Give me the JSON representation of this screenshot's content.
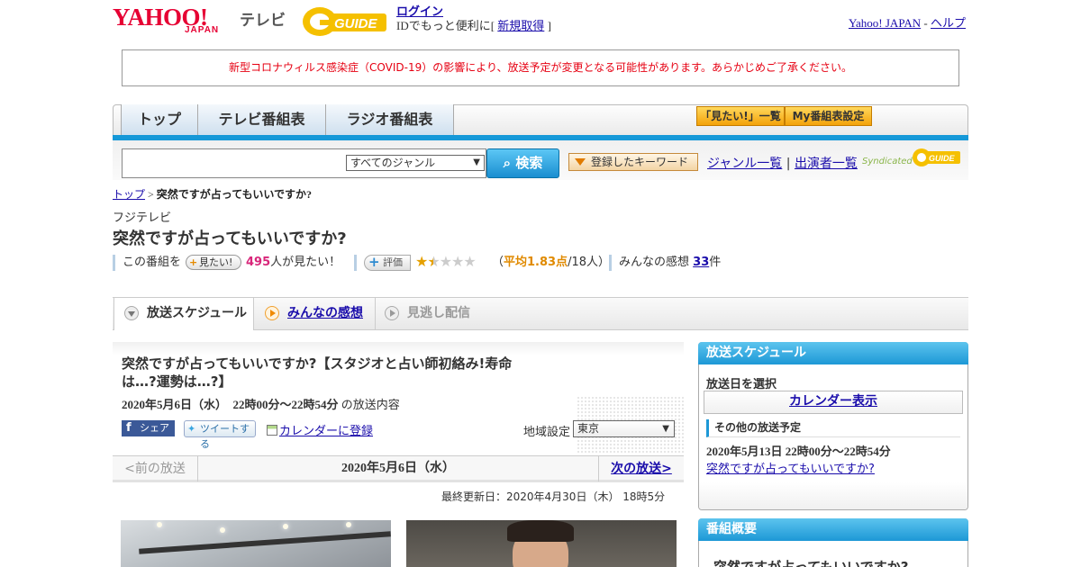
{
  "header": {
    "logo_text": "YAHOO!",
    "logo_sub": "JAPAN",
    "tv_label": "テレビ",
    "gguide_logo": "G GUIDE",
    "login": "ログイン",
    "login_desc": "IDでもっと便利に[",
    "signup": "新規取得",
    "login_desc_end": "]",
    "yahoo_japan": "Yahoo! JAPAN",
    "separator": "-",
    "help": "ヘルプ"
  },
  "notice": "新型コロナウィルス感染症（COVID-19）の影響により、放送予定が変更となる可能性があります。あらかじめご了承ください。",
  "nav": {
    "tabs": [
      "トップ",
      "テレビ番組表",
      "ラジオ番組表"
    ],
    "mitai_list": "「見たい!」一覧",
    "my_settings": "My番組表設定"
  },
  "search": {
    "genre": "すべてのジャンル",
    "button": "検索",
    "keyword_button": "登録したキーワード",
    "genre_list": "ジャンル一覧",
    "sep": "|",
    "performer_list": "出演者一覧",
    "syndicated": "Syndicated"
  },
  "breadcrumb": {
    "top": "トップ",
    "arrow": ">",
    "current": "突然ですが占ってもいいですか?"
  },
  "program": {
    "channel": "フジテレビ",
    "title": "突然ですが占ってもいいですか?",
    "mitai_prefix": "この番組を",
    "mitai_button": "見たい!",
    "mitai_count": "495",
    "mitai_suffix": "人が見たい！",
    "rate_button": "評価",
    "rating": 1.83,
    "rating_text_open": "（",
    "rating_avg": "平均1.83点",
    "rating_people": "/18人）",
    "review_prefix": "みんなの感想",
    "review_count": "33",
    "review_suffix": "件"
  },
  "tabs": {
    "schedule": "放送スケジュール",
    "reviews": "みんなの感想",
    "missed": "見逃し配信"
  },
  "episode": {
    "title": "突然ですが占ってもいいですか?【スタジオと占い師初絡み!寿命は…?運勢は…?】",
    "datetime": "2020年5月6日（水）　22時00分～22時54分",
    "datetime_suffix": "の放送内容",
    "share_fb": "シェア",
    "tweet": "ツイートする",
    "calendar": "カレンダーに登録",
    "region_label": "地域設定",
    "region": "東京"
  },
  "date_nav": {
    "prev": "<前の放送",
    "current": "2020年5月6日（水）",
    "next": "次の放送>"
  },
  "updated": "最終更新日：2020年4月30日（木）  18時5分",
  "sidebar": {
    "schedule_head": "放送スケジュール",
    "select_date": "放送日を選択",
    "calendar_view": "カレンダー表示",
    "other_head": "その他の放送予定",
    "other_time": "2020年5月13日  22時00分～22時54分",
    "other_link": "突然ですが占ってもいいですか?",
    "overview_head": "番組概要",
    "overview_title": "突然ですが占ってもいいですか?"
  },
  "colors": {
    "accent_blue": "#1598d8",
    "notice_red": "#e60012",
    "yahoo_red": "#e60033",
    "count_pink": "#d8267a",
    "rating_orange": "#e08a00"
  }
}
